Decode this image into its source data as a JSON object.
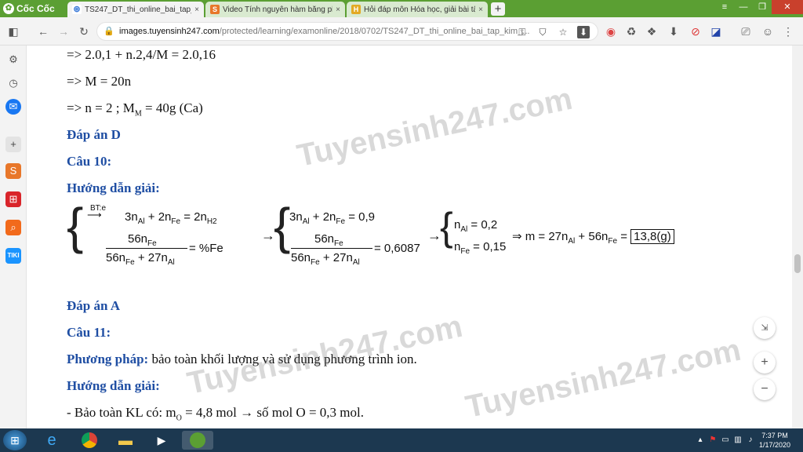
{
  "browser": {
    "brand": "Cốc Cốc",
    "tabs": [
      {
        "label": "TS247_DT_thi_online_bai_tap_kim_",
        "close": "×"
      },
      {
        "label": "Video Tính nguyên hàm bằng phư",
        "close": "×"
      },
      {
        "label": "Hỏi đáp môn Hóa học, giải bài tập",
        "close": "×"
      }
    ],
    "new_tab": "+",
    "url_host": "images.tuyensinh247.com",
    "url_path": "/protected/learning/examonline/2018/0702/TS247_DT_thi_online_bai_tap_kim_..."
  },
  "content": {
    "line1": "=> 2.0,1 + n.2,4/M = 2.0,16",
    "line2": "=> M = 20n",
    "line3a": "=> n = 2 ; M",
    "line3sub": "M",
    "line3b": " = 40g (Ca)",
    "answer_d": "Đáp án D",
    "q10": "Câu 10:",
    "guide1": "Hướng dẫn giải:",
    "answer_a": "Đáp án A",
    "q11": "Câu 11:",
    "method_label": "Phương pháp:",
    "method_text": " bảo toàn khối lượng và sử dụng phương trình ion.",
    "guide2": "Hướng dẫn giải:",
    "last_a": "- Bảo toàn KL có:  m",
    "last_sub": "O",
    "last_b": " = 4,8 mol → số mol O = 0,3 mol."
  },
  "math": {
    "bt": "BT:e",
    "eq1_a": "3n",
    "al": "Al",
    "eq1_b": " + 2n",
    "fe": "Fe",
    "eq1_c": " = 2n",
    "h2": "H2",
    "num1": "56n",
    "den1_a": "56n",
    "den1_b": " + 27n",
    "pct": " = %Fe",
    "arrow": "→",
    "eq2_a": "3n",
    "eq2_b": " + 2n",
    "eq2_c": " = 0,9",
    "val2": " = 0,6087",
    "nal": "n",
    "nal_val": " = 0,2",
    "nfe": "n",
    "nfe_val": " = 0,15",
    "implies": "⇒ m = 27n",
    "plus56": " + 56n",
    "eq_sign": " = ",
    "result": "13,8(g)"
  },
  "watermark": "Tuyensinh247.com",
  "taskbar": {
    "time": "7:37 PM",
    "date": "1/17/2020"
  }
}
